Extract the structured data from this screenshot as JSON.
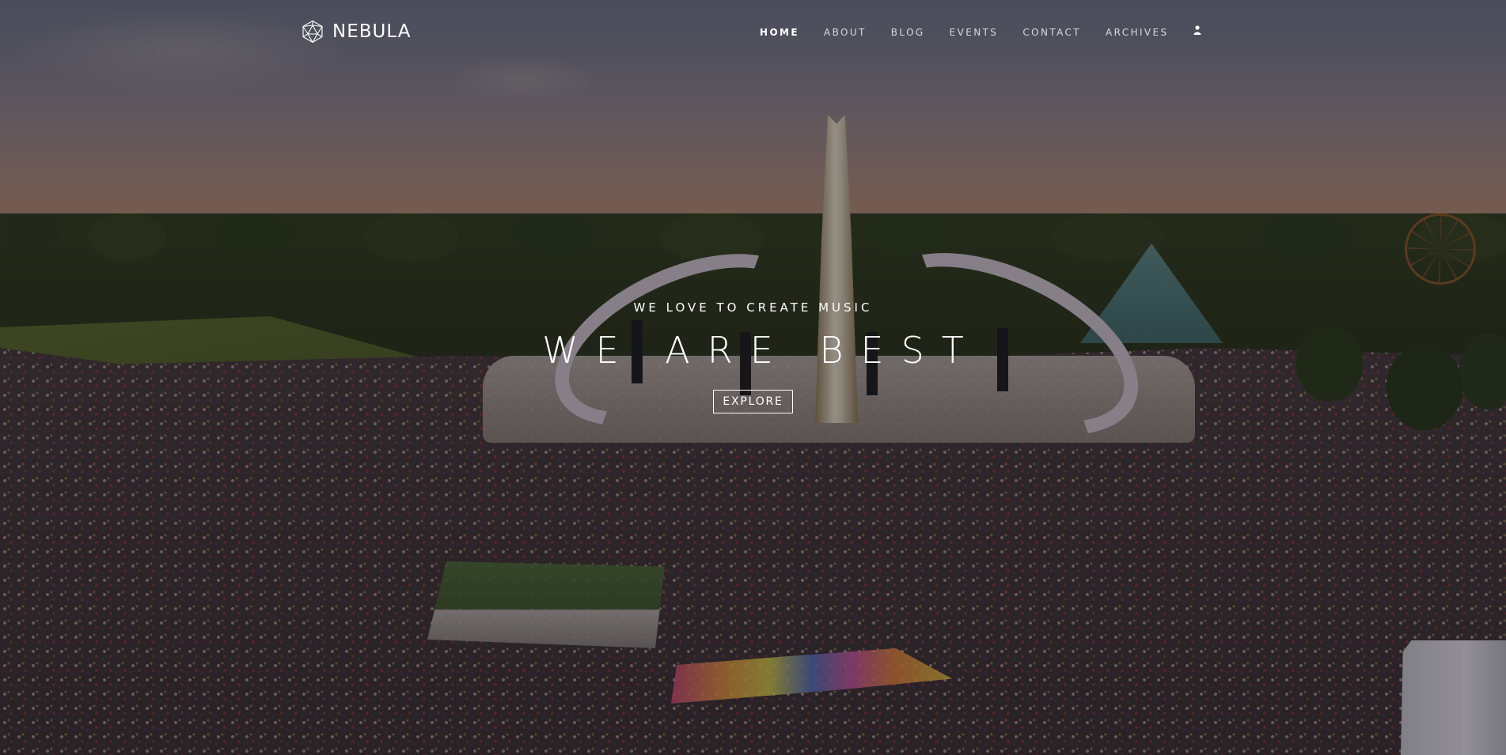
{
  "brand": {
    "name": "NEBULA",
    "logo_icon": "geodesic-hexagon-icon"
  },
  "nav": {
    "items": [
      {
        "label": "HOME",
        "active": true
      },
      {
        "label": "ABOUT",
        "active": false
      },
      {
        "label": "BLOG",
        "active": false
      },
      {
        "label": "EVENTS",
        "active": false
      },
      {
        "label": "CONTACT",
        "active": false
      },
      {
        "label": "ARCHIVES",
        "active": false
      }
    ],
    "user_icon": "user-icon"
  },
  "hero": {
    "tagline": "WE LOVE TO CREATE MUSIC",
    "headline": "WE ARE BEST",
    "button_label": "EXPLORE",
    "background": "aerial photo of a music festival main stage and crowd at sunset"
  },
  "colors": {
    "text": "#ffffff",
    "nav_inactive": "#c9c6cc",
    "overlay": "#0f0c14"
  }
}
